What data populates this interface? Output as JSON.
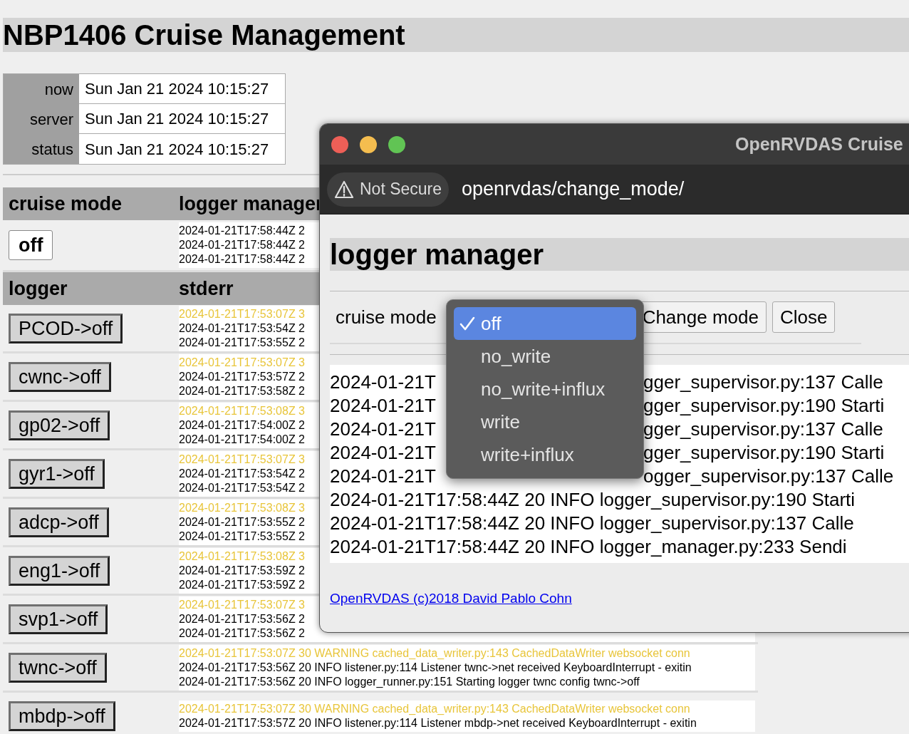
{
  "title": "NBP1406 Cruise Management",
  "clock": [
    {
      "label": "now",
      "value": "Sun Jan 21 2024 10:15:27"
    },
    {
      "label": "server",
      "value": "Sun Jan 21 2024 10:15:27"
    },
    {
      "label": "status",
      "value": "Sun Jan 21 2024 10:15:27"
    }
  ],
  "mode_table": {
    "columns": [
      "cruise mode",
      "logger manager"
    ],
    "mode_button": "off",
    "log": [
      {
        "kind": "info",
        "text": "2024-01-21T17:58:44Z 2"
      },
      {
        "kind": "info",
        "text": "2024-01-21T17:58:44Z 2"
      },
      {
        "kind": "info",
        "text": "2024-01-21T17:58:44Z 2"
      }
    ]
  },
  "logger_table": {
    "columns": [
      "logger",
      "stderr"
    ],
    "rows": [
      {
        "button": "PCOD->off",
        "log": [
          {
            "kind": "warning",
            "text": "2024-01-21T17:53:07Z 3"
          },
          {
            "kind": "info",
            "text": "2024-01-21T17:53:54Z 2"
          },
          {
            "kind": "info",
            "text": "2024-01-21T17:53:55Z 2"
          }
        ]
      },
      {
        "button": "cwnc->off",
        "log": [
          {
            "kind": "warning",
            "text": "2024-01-21T17:53:07Z 3"
          },
          {
            "kind": "info",
            "text": "2024-01-21T17:53:57Z 2"
          },
          {
            "kind": "info",
            "text": "2024-01-21T17:53:58Z 2"
          }
        ]
      },
      {
        "button": "gp02->off",
        "log": [
          {
            "kind": "warning",
            "text": "2024-01-21T17:53:08Z 3"
          },
          {
            "kind": "info",
            "text": "2024-01-21T17:54:00Z 2"
          },
          {
            "kind": "info",
            "text": "2024-01-21T17:54:00Z 2"
          }
        ]
      },
      {
        "button": "gyr1->off",
        "log": [
          {
            "kind": "warning",
            "text": "2024-01-21T17:53:07Z 3"
          },
          {
            "kind": "info",
            "text": "2024-01-21T17:53:54Z 2"
          },
          {
            "kind": "info",
            "text": "2024-01-21T17:53:54Z 2"
          }
        ]
      },
      {
        "button": "adcp->off",
        "log": [
          {
            "kind": "warning",
            "text": "2024-01-21T17:53:08Z 3"
          },
          {
            "kind": "info",
            "text": "2024-01-21T17:53:55Z 2"
          },
          {
            "kind": "info",
            "text": "2024-01-21T17:53:55Z 2"
          }
        ]
      },
      {
        "button": "eng1->off",
        "log": [
          {
            "kind": "warning",
            "text": "2024-01-21T17:53:08Z 3"
          },
          {
            "kind": "info",
            "text": "2024-01-21T17:53:59Z 2"
          },
          {
            "kind": "info",
            "text": "2024-01-21T17:53:59Z 2"
          }
        ]
      },
      {
        "button": "svp1->off",
        "log": [
          {
            "kind": "warning",
            "text": "2024-01-21T17:53:07Z 3"
          },
          {
            "kind": "info",
            "text": "2024-01-21T17:53:56Z 2"
          },
          {
            "kind": "info",
            "text": "2024-01-21T17:53:56Z 2"
          }
        ]
      },
      {
        "button": "twnc->off",
        "log": [
          {
            "kind": "warning",
            "text": "2024-01-21T17:53:07Z 30 WARNING cached_data_writer.py:143 CachedDataWriter websocket conn"
          },
          {
            "kind": "info",
            "text": "2024-01-21T17:53:56Z 20 INFO listener.py:114 Listener twnc->net received KeyboardInterrupt - exitin"
          },
          {
            "kind": "info",
            "text": "2024-01-21T17:53:56Z 20 INFO logger_runner.py:151 Starting logger twnc config twnc->off"
          }
        ]
      },
      {
        "button": "mbdp->off",
        "log": [
          {
            "kind": "warning",
            "text": "2024-01-21T17:53:07Z 30 WARNING cached_data_writer.py:143 CachedDataWriter websocket conn"
          },
          {
            "kind": "info",
            "text": "2024-01-21T17:53:57Z 20 INFO listener.py:114 Listener mbdp->net received KeyboardInterrupt - exitin"
          }
        ]
      }
    ]
  },
  "popup": {
    "window_title": "OpenRVDAS Cruise",
    "security": "Not Secure",
    "url": "openrvdas/change_mode/",
    "heading": "logger manager",
    "field_label": "cruise mode",
    "options": [
      {
        "label": "off",
        "selected": true
      },
      {
        "label": "no_write",
        "selected": false
      },
      {
        "label": "no_write+influx",
        "selected": false
      },
      {
        "label": "write",
        "selected": false
      },
      {
        "label": "write+influx",
        "selected": false
      }
    ],
    "buttons": [
      "Change mode",
      "Close"
    ],
    "log": [
      {
        "kind": "split",
        "start": "2024-01-21T",
        "end": "gger_supervisor.py:137 Calle"
      },
      {
        "kind": "split",
        "start": "2024-01-21T",
        "end": "gger_supervisor.py:190 Starti"
      },
      {
        "kind": "split",
        "start": "2024-01-21T",
        "end": "gger_supervisor.py:137 Calle"
      },
      {
        "kind": "split",
        "start": "2024-01-21T",
        "end": "gger_supervisor.py:190 Starti"
      },
      {
        "kind": "split",
        "start": "2024-01-21T",
        "end": "ogger_supervisor.py:137 Calle"
      },
      {
        "kind": "full",
        "text": "2024-01-21T17:58:44Z 20 INFO logger_supervisor.py:190 Starti"
      },
      {
        "kind": "full",
        "text": "2024-01-21T17:58:44Z 20 INFO logger_supervisor.py:137 Calle"
      },
      {
        "kind": "full",
        "text": "2024-01-21T17:58:44Z 20 INFO logger_manager.py:233 Sendi"
      }
    ],
    "footer_link": "OpenRVDAS (c)2018 David Pablo Cohn"
  }
}
